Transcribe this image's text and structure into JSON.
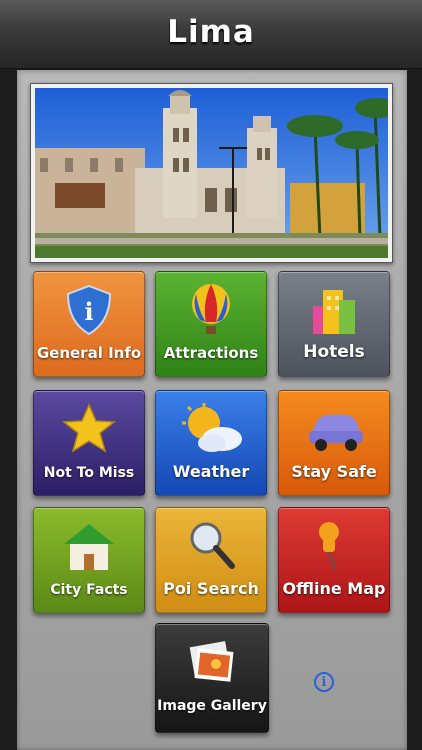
{
  "header": {
    "title": "Lima"
  },
  "tiles": [
    {
      "label": "General Info",
      "icon": "shield-info-icon",
      "color": "#e8742a"
    },
    {
      "label": "Attractions",
      "icon": "hot-air-balloon-icon",
      "color": "#3f9a22"
    },
    {
      "label": "Hotels",
      "icon": "buildings-icon",
      "color": "#5d6470"
    },
    {
      "label": "Not To Miss",
      "icon": "star-icon",
      "color": "#3c2e7e"
    },
    {
      "label": "Weather",
      "icon": "sun-cloud-icon",
      "color": "#1d5dcc"
    },
    {
      "label": "Stay Safe",
      "icon": "car-icon",
      "color": "#e4680c"
    },
    {
      "label": "City Facts",
      "icon": "house-icon",
      "color": "#6f9e1f"
    },
    {
      "label": "Poi Search",
      "icon": "magnifier-icon",
      "color": "#e1a21a"
    },
    {
      "label": "Offline Map",
      "icon": "map-pin-icon",
      "color": "#c81f22"
    },
    {
      "label": "Image Gallery",
      "icon": "photo-stack-icon",
      "color": "#2c2c2c"
    }
  ],
  "info_button": {
    "glyph": "i"
  }
}
